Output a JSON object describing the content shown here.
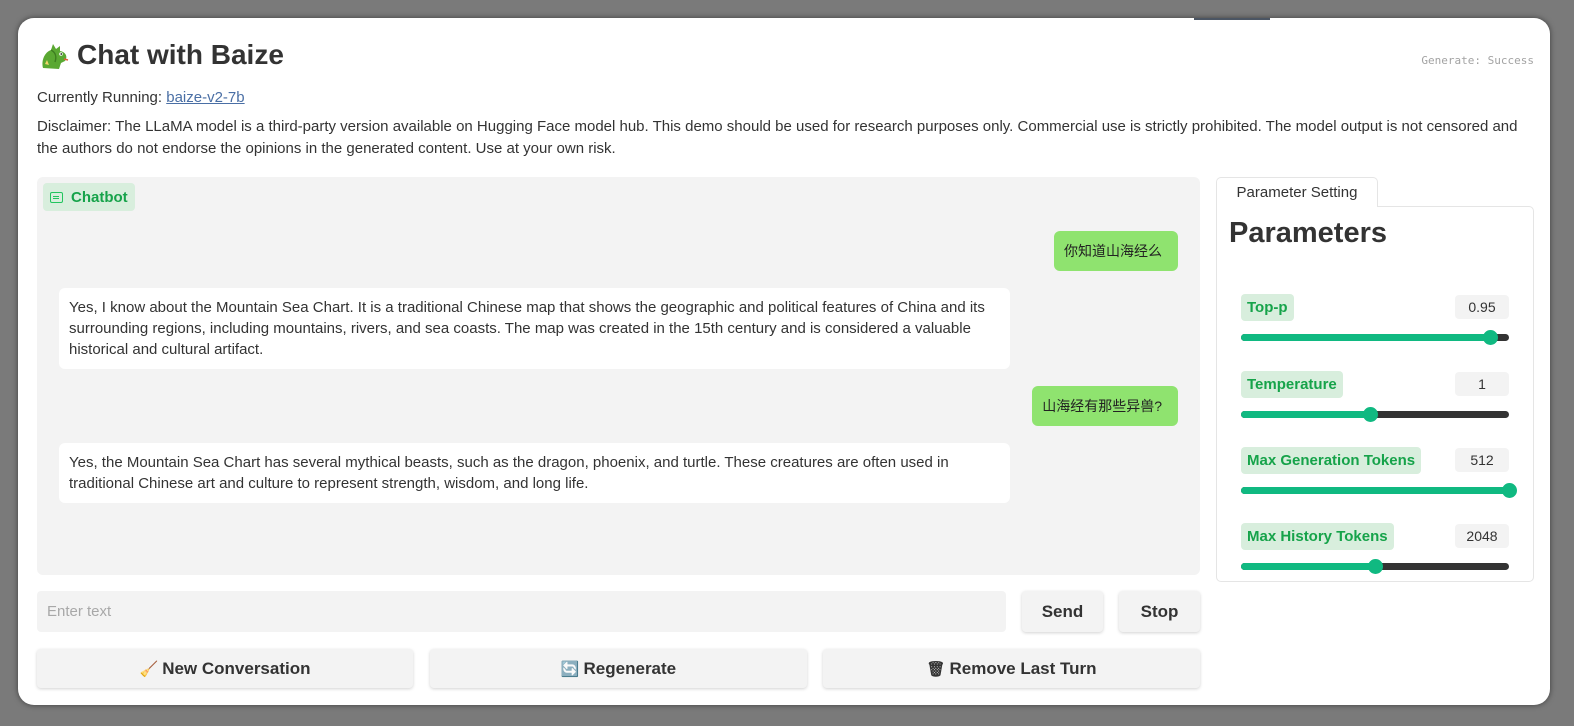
{
  "header": {
    "title": "Chat with Baize",
    "status": "Generate: Success",
    "running_prefix": "Currently Running: ",
    "model_link": "baize-v2-7b",
    "disclaimer": "Disclaimer: The LLaMA model is a third-party version available on Hugging Face model hub. This demo should be used for research purposes only. Commercial use is strictly prohibited. The model output is not censored and the authors do not endorse the opinions in the generated content. Use at your own risk."
  },
  "chatbot": {
    "label": "Chatbot",
    "messages": [
      {
        "role": "user",
        "text": "你知道山海经么"
      },
      {
        "role": "bot",
        "text": "Yes, I know about the Mountain Sea Chart. It is a traditional Chinese map that shows the geographic and political features of China and its surrounding regions, including mountains, rivers, and sea coasts. The map was created in the 15th century and is considered a valuable historical and cultural artifact."
      },
      {
        "role": "user",
        "text": "山海经有那些异兽?"
      },
      {
        "role": "bot",
        "text": "Yes, the Mountain Sea Chart has several mythical beasts, such as the dragon, phoenix, and turtle. These creatures are often used in traditional Chinese art and culture to represent strength, wisdom, and long life."
      }
    ]
  },
  "input": {
    "placeholder": "Enter text",
    "value": ""
  },
  "buttons": {
    "send": "Send",
    "stop": "Stop",
    "new_conversation": "New Conversation",
    "regenerate": "Regenerate",
    "remove_last_turn": "Remove Last Turn"
  },
  "parameters": {
    "tab_label": "Parameter Setting",
    "heading": "Parameters",
    "items": [
      {
        "label": "Top-p",
        "value": "0.95",
        "fraction": 0.93
      },
      {
        "label": "Temperature",
        "value": "1",
        "fraction": 0.48
      },
      {
        "label": "Max Generation Tokens",
        "value": "512",
        "fraction": 1.0
      },
      {
        "label": "Max History Tokens",
        "value": "2048",
        "fraction": 0.5
      }
    ]
  },
  "colors": {
    "accent": "#10b981",
    "label_text": "#16a34a",
    "user_bubble": "#8fe36f"
  },
  "icons": {
    "title": "dragon-icon",
    "chatbot": "chat-bubble-icon",
    "new_conversation": "broom-icon",
    "regenerate": "refresh-icon",
    "remove_last_turn": "trash-icon"
  }
}
